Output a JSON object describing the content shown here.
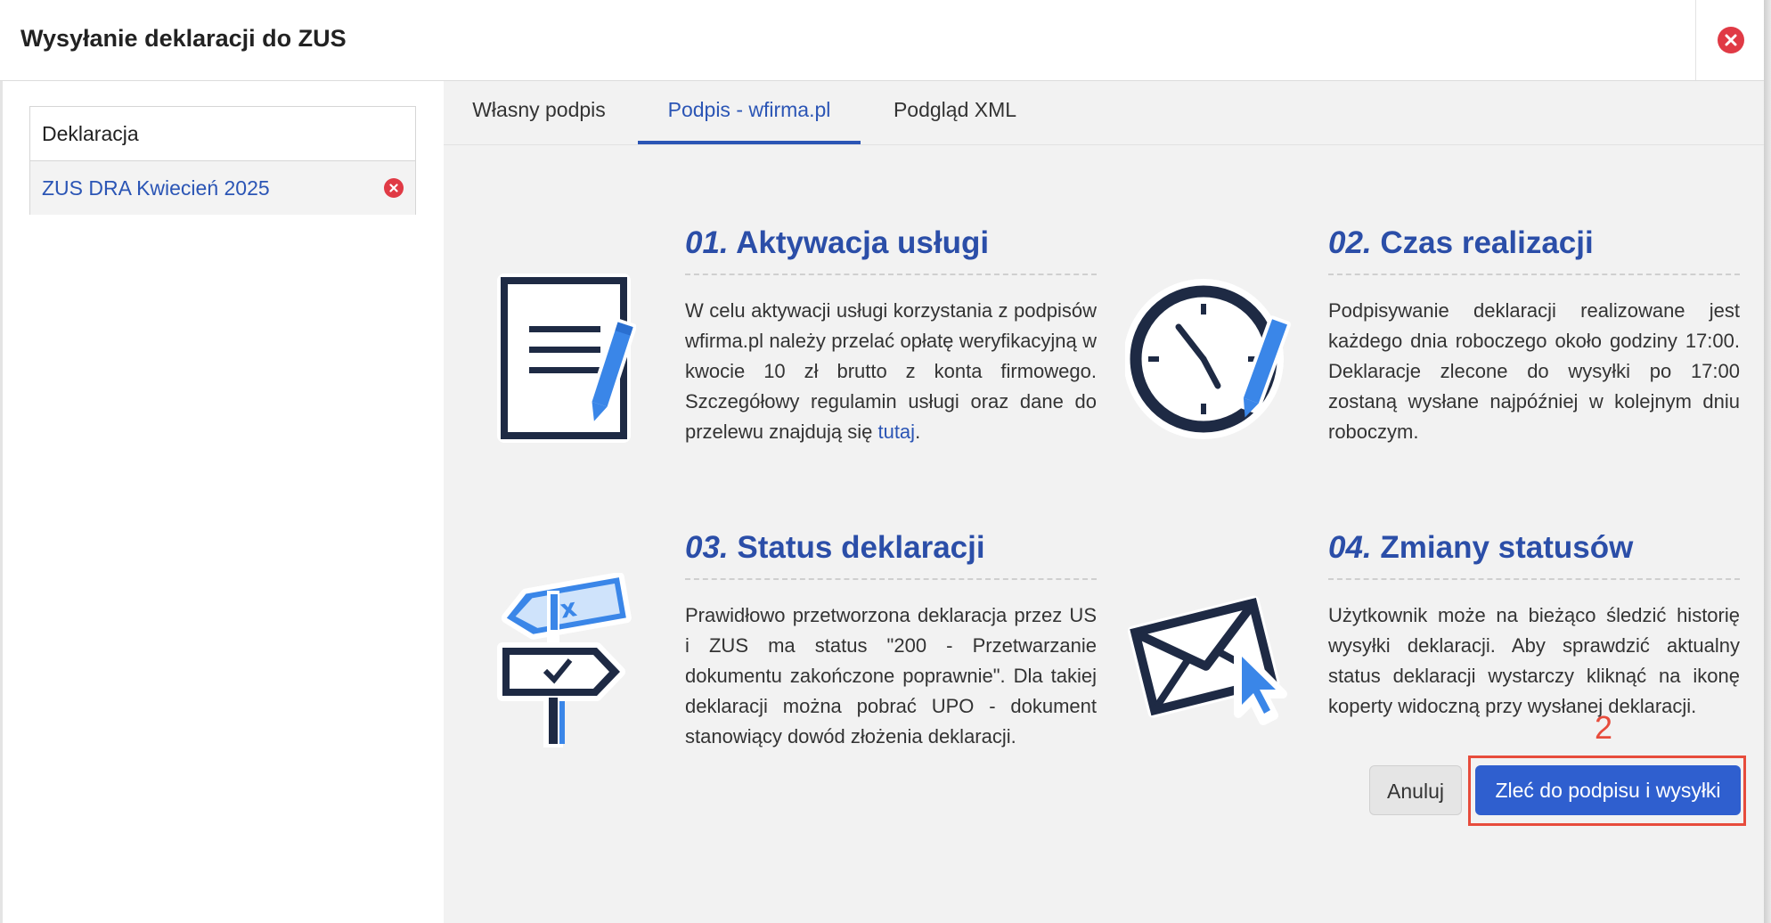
{
  "window": {
    "title": "Wysyłanie deklaracji do ZUS"
  },
  "declarations": {
    "header": "Deklaracja",
    "items": [
      {
        "label": "ZUS DRA Kwiecień 2025"
      }
    ]
  },
  "tabs": [
    {
      "label": "Własny podpis",
      "active": false
    },
    {
      "label": "Podpis - wfirma.pl",
      "active": true
    },
    {
      "label": "Podgląd XML",
      "active": false
    }
  ],
  "features": [
    {
      "num": "01.",
      "title": "Aktywacja usługi",
      "text": "W celu aktywacji usługi korzystania z podpisów wfirma.pl należy przelać opłatę weryfikacyjną w kwocie 10 zł brutto z konta firmowego. Szczegółowy regulamin usługi oraz dane do przelewu znajdują się ",
      "link": "tutaj",
      "text_after": ".",
      "icon": "document-pen-icon"
    },
    {
      "num": "02.",
      "title": "Czas realizacji",
      "text": "Podpisywanie deklaracji realizowane jest każdego dnia roboczego około godziny 17:00. Deklaracje zlecone do wysyłki po 17:00 zostaną wysłane najpóźniej w kolejnym dniu roboczym.",
      "icon": "clock-pen-icon"
    },
    {
      "num": "03.",
      "title": "Status deklaracji",
      "text": "Prawidłowo przetworzona deklaracja przez US i ZUS ma status \"200 - Przetwarzanie dokumentu zakończone poprawnie\". Dla takiej deklaracji można pobrać UPO - dokument stanowiący dowód złożenia deklaracji.",
      "icon": "signpost-icon"
    },
    {
      "num": "04.",
      "title": "Zmiany statusów",
      "text": "Użytkownik może na bieżąco śledzić historię wysyłki deklaracji. Aby sprawdzić aktualny status deklaracji wystarczy kliknąć na ikonę koperty widoczną przy wysłanej deklaracji.",
      "icon": "envelope-cursor-icon"
    }
  ],
  "buttons": {
    "cancel": "Anuluj",
    "submit": "Zleć do podpisu i wysyłki"
  },
  "annotation": {
    "step": "2"
  },
  "colors": {
    "accent": "#2f5fcf",
    "title_blue": "#2b4ea8",
    "danger": "#e03a45",
    "annotation": "#e74c3c"
  }
}
